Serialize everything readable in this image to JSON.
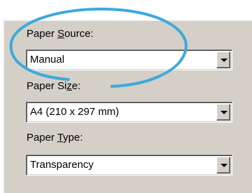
{
  "fields": [
    {
      "label_pre": "Paper ",
      "label_accel": "S",
      "label_post": "ource:",
      "value": "Manual"
    },
    {
      "label_pre": "Paper Si",
      "label_accel": "z",
      "label_post": "e:",
      "value": "A4 (210 x 297 mm)"
    },
    {
      "label_pre": "Paper ",
      "label_accel": "T",
      "label_post": "ype:",
      "value": "Transparency"
    }
  ],
  "colors": {
    "panel_background": "#d4d0c8",
    "highlight_ellipse": "#3da9dc"
  },
  "icons": {
    "dropdown": "chevron-down-icon"
  }
}
